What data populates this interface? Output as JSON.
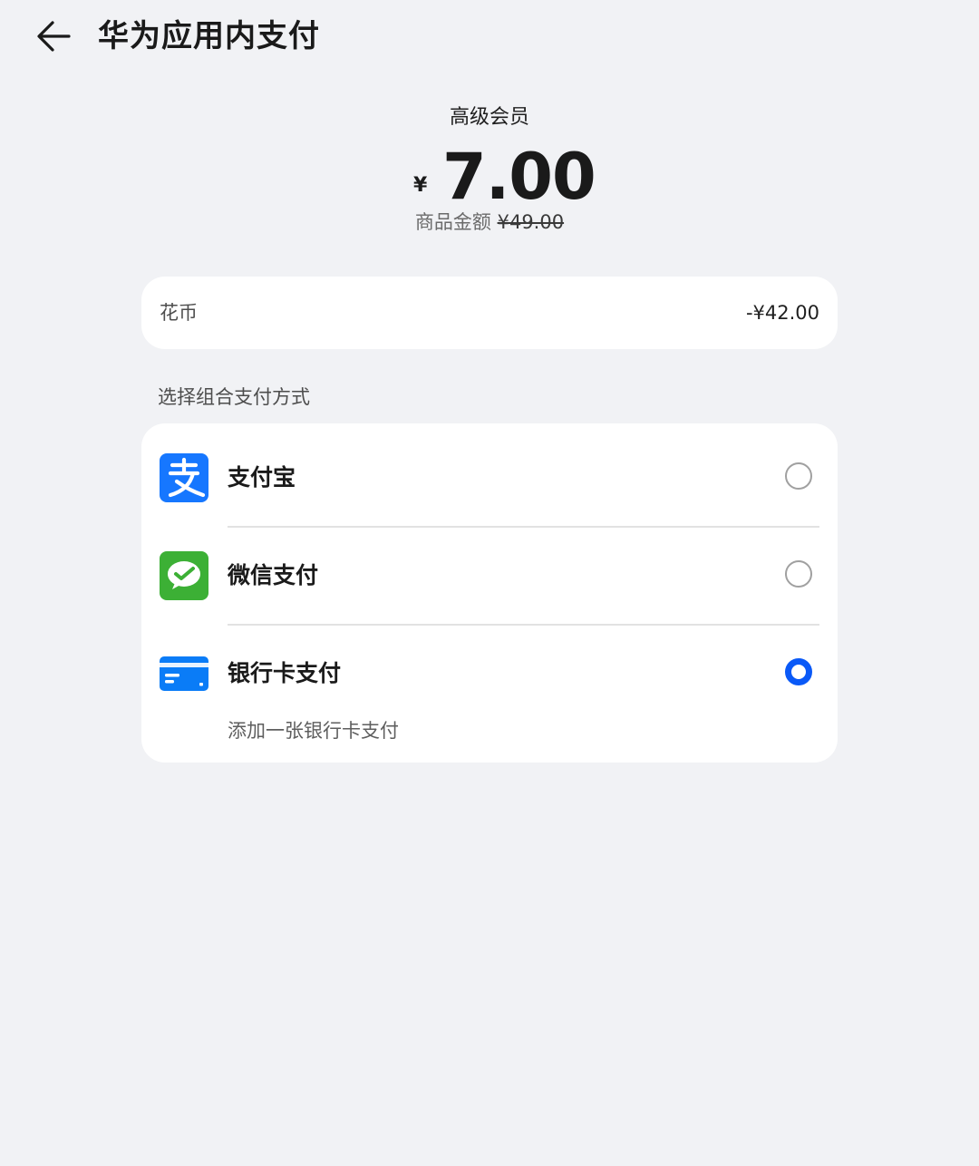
{
  "header": {
    "title": "华为应用内支付",
    "back_icon": "arrow-left-icon"
  },
  "order": {
    "product_name": "高级会员",
    "currency_symbol": "¥",
    "amount": "7.00",
    "original_label": "商品金额",
    "original_value": "¥49.00"
  },
  "coins": {
    "label": "花币",
    "value": "-¥42.00"
  },
  "payment": {
    "section_label": "选择组合支付方式",
    "methods": [
      {
        "label": "支付宝",
        "icon": "alipay-icon",
        "selected": false,
        "icon_color": "#1677ff"
      },
      {
        "label": "微信支付",
        "icon": "wechat-pay-icon",
        "selected": false,
        "icon_color": "#3cb035"
      },
      {
        "label": "银行卡支付",
        "icon": "bank-card-icon",
        "selected": true,
        "icon_color": "#0a7cf7"
      }
    ],
    "add_card_text": "添加一张银行卡支付"
  },
  "colors": {
    "accent": "#0a59f7",
    "background": "#f1f2f5",
    "card": "#ffffff"
  }
}
